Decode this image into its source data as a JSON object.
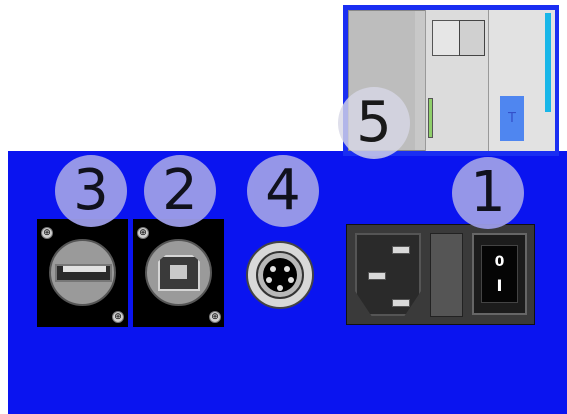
{
  "callouts": [
    {
      "id": "badge1",
      "number": "1"
    },
    {
      "id": "badge2",
      "number": "2"
    },
    {
      "id": "badge3",
      "number": "3"
    },
    {
      "id": "badge4",
      "number": "4"
    },
    {
      "id": "badge5",
      "number": "5"
    }
  ],
  "power_switch": {
    "off_symbol": "0",
    "on_symbol": "I"
  },
  "device_label": "T",
  "colors": {
    "panel": "#0a14f0",
    "badge": "#9d9de8",
    "connector": "#000000",
    "led": "#8fcf6a",
    "indicator_strip": "#17b6e8"
  },
  "components": [
    {
      "callout": "1",
      "icon": "power-inlet-switch-icon"
    },
    {
      "callout": "2",
      "icon": "usb-b-port-icon"
    },
    {
      "callout": "3",
      "icon": "usb-a-port-icon"
    },
    {
      "callout": "4",
      "icon": "mini-din-port-icon"
    },
    {
      "callout": "5",
      "icon": "card-slot-module-icon"
    }
  ]
}
